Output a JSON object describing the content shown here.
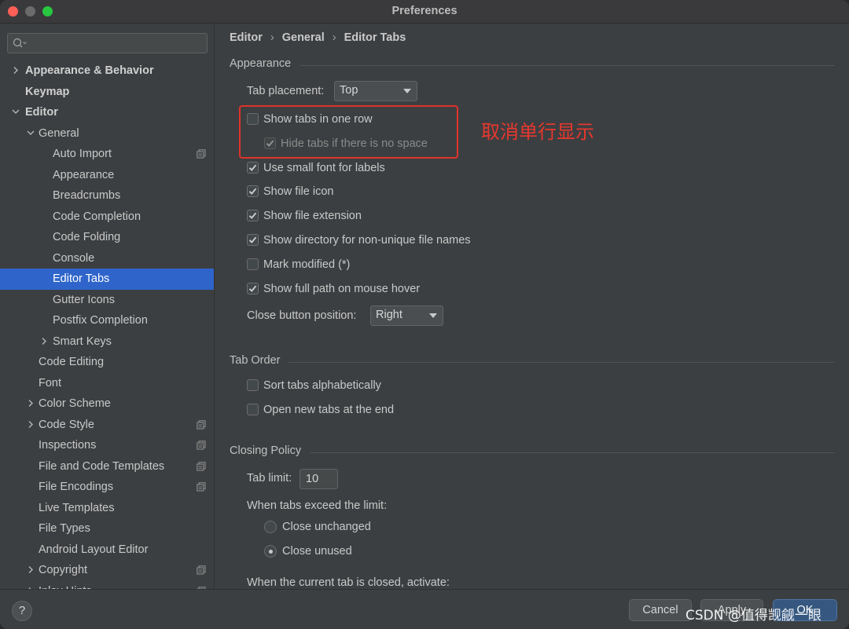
{
  "window": {
    "title": "Preferences"
  },
  "search": {
    "placeholder": ""
  },
  "sidebar": {
    "items": [
      {
        "label": "Appearance & Behavior",
        "level": 0,
        "expander": "collapsed",
        "bold": true
      },
      {
        "label": "Keymap",
        "level": 0,
        "expander": "none",
        "bold": true
      },
      {
        "label": "Editor",
        "level": 0,
        "expander": "expanded",
        "bold": true
      },
      {
        "label": "General",
        "level": 1,
        "expander": "expanded"
      },
      {
        "label": "Auto Import",
        "level": 2,
        "expander": "none",
        "icon": "copy"
      },
      {
        "label": "Appearance",
        "level": 2,
        "expander": "none"
      },
      {
        "label": "Breadcrumbs",
        "level": 2,
        "expander": "none"
      },
      {
        "label": "Code Completion",
        "level": 2,
        "expander": "none"
      },
      {
        "label": "Code Folding",
        "level": 2,
        "expander": "none"
      },
      {
        "label": "Console",
        "level": 2,
        "expander": "none"
      },
      {
        "label": "Editor Tabs",
        "level": 2,
        "expander": "none",
        "selected": true
      },
      {
        "label": "Gutter Icons",
        "level": 2,
        "expander": "none"
      },
      {
        "label": "Postfix Completion",
        "level": 2,
        "expander": "none"
      },
      {
        "label": "Smart Keys",
        "level": 2,
        "expander": "collapsed"
      },
      {
        "label": "Code Editing",
        "level": 1,
        "expander": "none"
      },
      {
        "label": "Font",
        "level": 1,
        "expander": "none"
      },
      {
        "label": "Color Scheme",
        "level": 1,
        "expander": "collapsed"
      },
      {
        "label": "Code Style",
        "level": 1,
        "expander": "collapsed",
        "icon": "copy"
      },
      {
        "label": "Inspections",
        "level": 1,
        "expander": "none",
        "icon": "copy"
      },
      {
        "label": "File and Code Templates",
        "level": 1,
        "expander": "none",
        "icon": "copy"
      },
      {
        "label": "File Encodings",
        "level": 1,
        "expander": "none",
        "icon": "copy"
      },
      {
        "label": "Live Templates",
        "level": 1,
        "expander": "none"
      },
      {
        "label": "File Types",
        "level": 1,
        "expander": "none"
      },
      {
        "label": "Android Layout Editor",
        "level": 1,
        "expander": "none"
      },
      {
        "label": "Copyright",
        "level": 1,
        "expander": "collapsed",
        "icon": "copy"
      },
      {
        "label": "Inlay Hints",
        "level": 1,
        "expander": "collapsed",
        "icon": "copy"
      }
    ]
  },
  "breadcrumb": {
    "parts": [
      "Editor",
      "General",
      "Editor Tabs"
    ]
  },
  "appearance": {
    "title": "Appearance",
    "tab_placement_label": "Tab placement:",
    "tab_placement_value": "Top",
    "show_tabs_one_row": {
      "label": "Show tabs in one row",
      "checked": false
    },
    "hide_tabs_no_space": {
      "label": "Hide tabs if there is no space",
      "checked": true,
      "disabled": true
    },
    "small_font": {
      "label": "Use small font for labels",
      "checked": true
    },
    "file_icon": {
      "label": "Show file icon",
      "checked": true
    },
    "file_extension": {
      "label": "Show file extension",
      "checked": true
    },
    "directory_nonunique": {
      "label": "Show directory for non-unique file names",
      "checked": true
    },
    "mark_modified": {
      "label": "Mark modified (*)",
      "checked": false
    },
    "full_path_hover": {
      "label": "Show full path on mouse hover",
      "checked": true
    },
    "close_button_label": "Close button position:",
    "close_button_value": "Right"
  },
  "tab_order": {
    "title": "Tab Order",
    "sort_alpha": {
      "label": "Sort tabs alphabetically",
      "checked": false
    },
    "open_at_end": {
      "label": "Open new tabs at the end",
      "checked": false
    }
  },
  "closing_policy": {
    "title": "Closing Policy",
    "tab_limit_label": "Tab limit:",
    "tab_limit_value": "10",
    "exceed_label": "When tabs exceed the limit:",
    "close_unchanged": {
      "label": "Close unchanged",
      "selected": false
    },
    "close_unused": {
      "label": "Close unused",
      "selected": true
    },
    "activate_label": "When the current tab is closed, activate:"
  },
  "annotation": {
    "text": "取消单行显示",
    "color": "#e8372e"
  },
  "footer": {
    "help_label": "?",
    "cancel_label": "Cancel",
    "apply_label": "Apply",
    "ok_label": "OK"
  },
  "watermark": {
    "text": "CSDN @值得觊觎一眼"
  },
  "colors": {
    "selection": "#2f65ca",
    "annotation": "#e0322a",
    "background": "#3c3f41"
  }
}
